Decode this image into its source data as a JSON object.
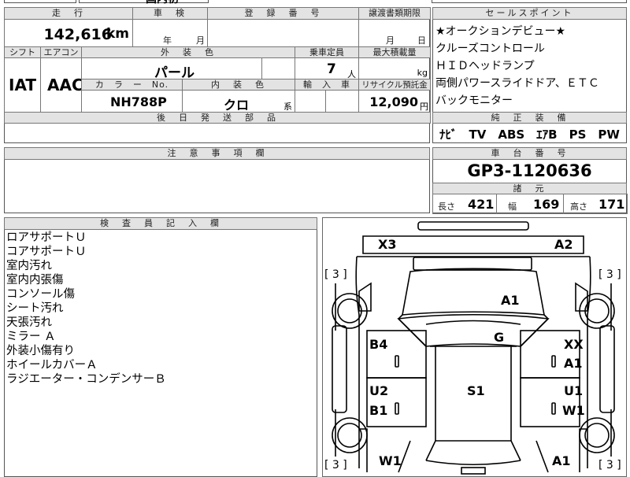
{
  "top": {
    "partial_title": "国内初"
  },
  "mileage": {
    "label": "走　行",
    "value": "142,616",
    "unit": "km"
  },
  "inspection": {
    "label": "車　検",
    "year": "年",
    "month": "月"
  },
  "registration": {
    "label": "登　録　番　号"
  },
  "transfer": {
    "label": "譲渡書類期限",
    "month": "月",
    "day": "日"
  },
  "shift": {
    "label": "シフト",
    "value": "IAT"
  },
  "aircon": {
    "label": "エアコン",
    "value": "AAC"
  },
  "exterior": {
    "label": "外　装　色",
    "value": "パール"
  },
  "capacity": {
    "label": "乗車定員",
    "value": "7",
    "unit": "人"
  },
  "max_load": {
    "label": "最大積載量",
    "unit": "kg"
  },
  "color_no": {
    "label": "カ　ラ　ー　No.",
    "value": "NH788P"
  },
  "interior": {
    "label": "内　装　色",
    "value": "クロ",
    "suffix": "系"
  },
  "import": {
    "label": "輸　入　車"
  },
  "recycle": {
    "label": "リサイクル預託金",
    "value": "12,090",
    "unit": "円"
  },
  "later_parts": {
    "label": "後　日　発　送　部　品"
  },
  "notes": {
    "label": "注　意　事　項　欄"
  },
  "sales": {
    "label": "セールスポイント",
    "lines": [
      "★オークションデビュー★",
      "クルーズコントロール",
      "ＨＩＤヘッドランプ",
      "両側パワースライドドア、ＥＴＣ",
      "バックモニター"
    ]
  },
  "equipment": {
    "label": "純　正　装　備",
    "items": "ﾅﾋﾞ　TV　ABS　ｴｱB　PS　PW"
  },
  "chassis": {
    "label": "車　台　番　号",
    "value": "GP3-1120636"
  },
  "specs": {
    "label": "諸　元",
    "length_label": "長さ",
    "length": "421",
    "width_label": "幅",
    "width": "169",
    "height_label": "高さ",
    "height": "171"
  },
  "inspector": {
    "label": "検　査　員　記　入　欄",
    "lines": [
      "ロアサポートＵ",
      "コアサポートＵ",
      "室内汚れ",
      "室内内張傷",
      "コンソール傷",
      "シート汚れ",
      "天張汚れ",
      "ミラー Ａ",
      "外装小傷有り",
      "ホイールカバーＡ",
      "ラジエーター・コンデンサーＢ"
    ]
  },
  "diagram": {
    "bracket_tl": "[ 3 ]",
    "bracket_tr": "[ 3 ]",
    "bracket_bl": "[ 3 ]",
    "bracket_br": "[ 3 ]",
    "x3": "X3",
    "a2": "A2",
    "a1_hood": "A1",
    "g": "G",
    "b4": "B4",
    "xx": "XX",
    "a1_rf": "A1",
    "u2": "U2",
    "b1": "B1",
    "s1": "S1",
    "u1": "U1",
    "w1_r": "W1",
    "w1_bl": "W1",
    "a1_br": "A1"
  }
}
